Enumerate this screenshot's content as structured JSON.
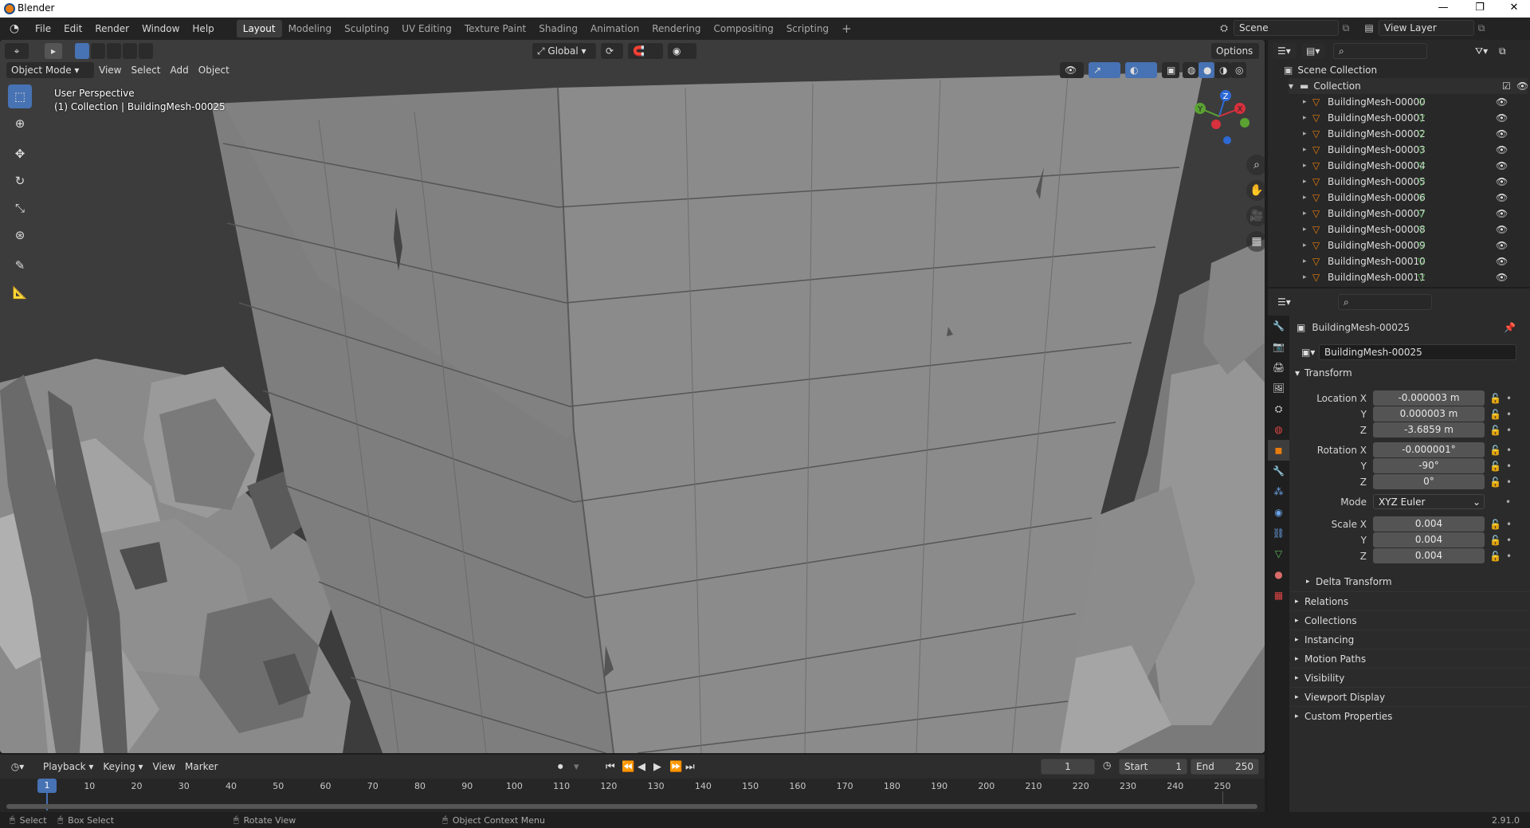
{
  "window": {
    "title": "Blender"
  },
  "menu": [
    "File",
    "Edit",
    "Render",
    "Window",
    "Help"
  ],
  "workspaces": [
    "Layout",
    "Modeling",
    "Sculpting",
    "UV Editing",
    "Texture Paint",
    "Shading",
    "Animation",
    "Rendering",
    "Compositing",
    "Scripting"
  ],
  "active_workspace": "Layout",
  "scene": {
    "label": "Scene",
    "view_layer": "View Layer"
  },
  "viewport": {
    "header": {
      "orientation": "Global",
      "options": "Options"
    },
    "mode": "Object Mode",
    "menus": [
      "View",
      "Select",
      "Add",
      "Object"
    ],
    "overlay_line1": "User Perspective",
    "overlay_line2": "(1) Collection | BuildingMesh-00025",
    "gizmo": {
      "x": "X",
      "y": "Y",
      "z": "Z"
    }
  },
  "outliner": {
    "scene_collection": "Scene Collection",
    "collection": "Collection",
    "items": [
      "BuildingMesh-00000",
      "BuildingMesh-00001",
      "BuildingMesh-00002",
      "BuildingMesh-00003",
      "BuildingMesh-00004",
      "BuildingMesh-00005",
      "BuildingMesh-00006",
      "BuildingMesh-00007",
      "BuildingMesh-00008",
      "BuildingMesh-00009",
      "BuildingMesh-00010",
      "BuildingMesh-00011"
    ]
  },
  "properties": {
    "object_name": "BuildingMesh-00025",
    "name_field": "BuildingMesh-00025",
    "transform_label": "Transform",
    "location": {
      "label": "Location X",
      "x": "-0.000003 m",
      "y": "0.000003 m",
      "z": "-3.6859 m"
    },
    "rotation": {
      "label": "Rotation X",
      "x": "-0.000001°",
      "y": "-90°",
      "z": "0°"
    },
    "mode": {
      "label": "Mode",
      "value": "XYZ Euler"
    },
    "scale": {
      "label": "Scale X",
      "x": "0.004",
      "y": "0.004",
      "z": "0.004"
    },
    "axis": {
      "y": "Y",
      "z": "Z"
    },
    "delta": "Delta Transform",
    "panels": [
      "Relations",
      "Collections",
      "Instancing",
      "Motion Paths",
      "Visibility",
      "Viewport Display",
      "Custom Properties"
    ]
  },
  "timeline": {
    "menus": [
      "Playback",
      "Keying",
      "View",
      "Marker"
    ],
    "current_frame": "1",
    "start_label": "Start",
    "start": "1",
    "end_label": "End",
    "end": "250",
    "ticks": [
      "10",
      "20",
      "30",
      "40",
      "50",
      "60",
      "70",
      "80",
      "90",
      "100",
      "110",
      "120",
      "130",
      "140",
      "150",
      "160",
      "170",
      "180",
      "190",
      "200",
      "210",
      "220",
      "230",
      "240",
      "250"
    ],
    "playhead": "1"
  },
  "status": {
    "select": "Select",
    "box_select": "Box Select",
    "rotate": "Rotate View",
    "context": "Object Context Menu",
    "version": "2.91.0"
  },
  "colors": {
    "accent": "#4772b3",
    "mesh_icon": "#e87d0d",
    "data_icon": "#5fbe5f"
  }
}
